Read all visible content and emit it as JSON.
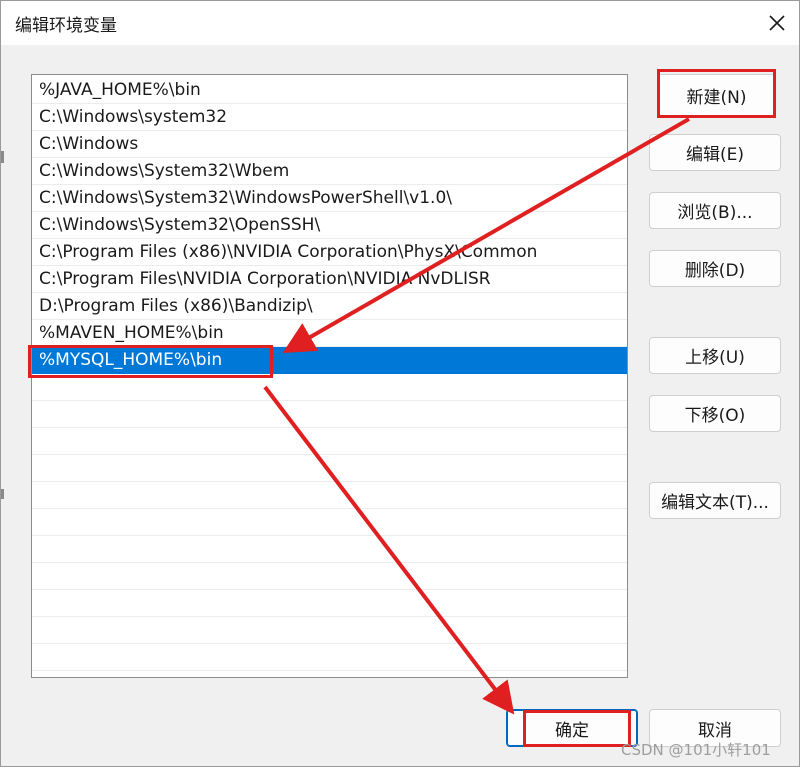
{
  "window": {
    "title": "编辑环境变量"
  },
  "paths": [
    "%JAVA_HOME%\\bin",
    "C:\\Windows\\system32",
    "C:\\Windows",
    "C:\\Windows\\System32\\Wbem",
    "C:\\Windows\\System32\\WindowsPowerShell\\v1.0\\",
    "C:\\Windows\\System32\\OpenSSH\\",
    "C:\\Program Files (x86)\\NVIDIA Corporation\\PhysX\\Common",
    "C:\\Program Files\\NVIDIA Corporation\\NVIDIA NvDLISR",
    "D:\\Program Files (x86)\\Bandizip\\",
    "%MAVEN_HOME%\\bin",
    "%MYSQL_HOME%\\bin"
  ],
  "selected_index": 10,
  "buttons": {
    "new": "新建(N)",
    "edit": "编辑(E)",
    "browse": "浏览(B)...",
    "delete": "删除(D)",
    "move_up": "上移(U)",
    "move_down": "下移(O)",
    "edit_text": "编辑文本(T)...",
    "ok": "确定",
    "cancel": "取消"
  },
  "watermark": "CSDN @101小轩101",
  "colors": {
    "selection": "#0078d7",
    "annotation": "#e02020"
  },
  "icons": {
    "close": "close-icon"
  }
}
